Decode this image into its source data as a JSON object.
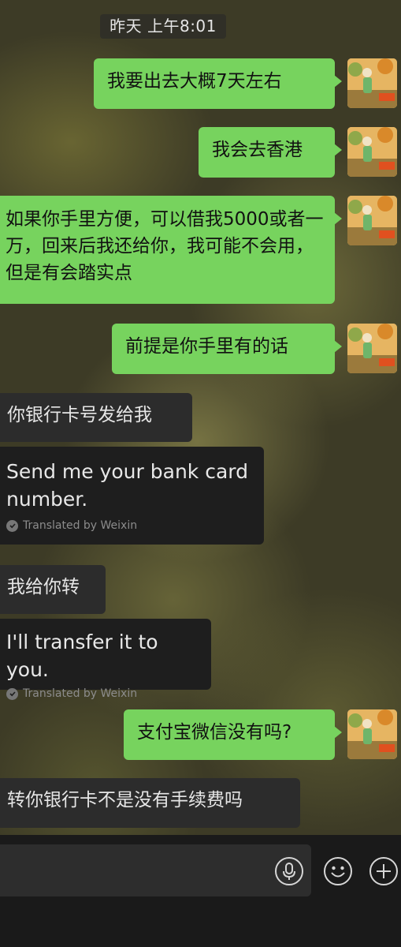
{
  "timestamp": "昨天 上午8:01",
  "messages": {
    "m1": "我要出去大概7天左右",
    "m2": "我会去香港",
    "m3": "如果你手里方便，可以借我5000或者一万，回来后我还给你，我可能不会用，但是有会踏实点",
    "m4": "前提是你手里有的话",
    "m5": "你银行卡号发给我",
    "m6": "我给你转",
    "m7": "支付宝微信没有吗?",
    "m8": "转你银行卡不是没有手续费吗"
  },
  "translations": {
    "t1": "Send me your bank card number.",
    "t2": "I'll transfer it to you.",
    "note": "Translated by Weixin"
  },
  "icons": {
    "voice": "voice-input-icon",
    "emoji": "emoji-icon",
    "more": "plus-icon"
  },
  "colors": {
    "outgoing_bubble": "#77d35e",
    "incoming_bubble": "#2c2c2c",
    "input_bar": "#1a1a1a"
  }
}
